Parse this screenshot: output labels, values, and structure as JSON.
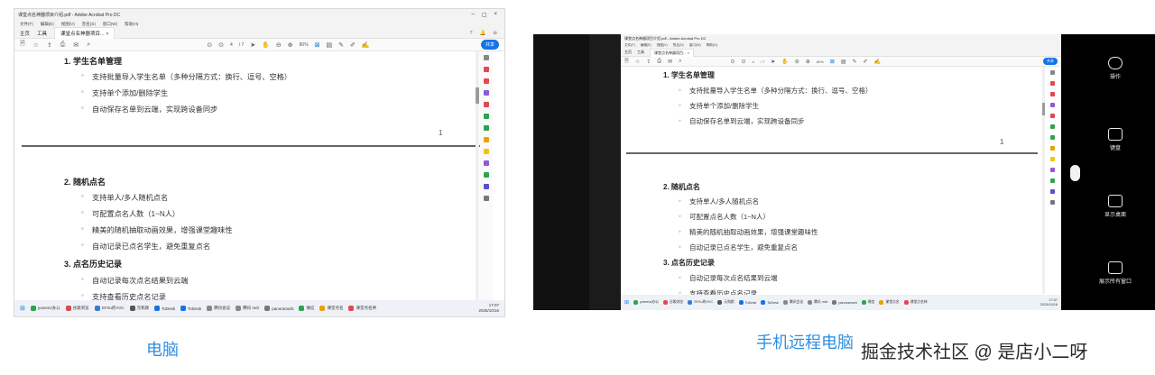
{
  "pc": {
    "title": "课堂点名神器项目介绍.pdf - Adobe Acrobat Pro DC",
    "menu": [
      "文件(F)",
      "编辑(E)",
      "视图(V)",
      "签名(S)",
      "窗口(W)",
      "帮助(H)"
    ],
    "tabs": [
      "主页",
      "工具"
    ],
    "doc_tab": "课堂点名神器项目...",
    "page_input": "4",
    "page_total": "/ 7",
    "zoom": "80%",
    "share_label": "共享",
    "clock_time": "17:07",
    "clock_date": "2025/10/16"
  },
  "phone": {
    "title": "课堂点名神器项目介绍.pdf - Adobe Acrobat Pro DC",
    "menu": [
      "文件(F)",
      "编辑(E)",
      "视图(V)",
      "签名(S)",
      "窗口(W)",
      "帮助(H)"
    ],
    "tabs": [
      "主页",
      "工具"
    ],
    "doc_tab": "课堂点名神器项目...",
    "page_input": "4",
    "page_total": "/ 7",
    "zoom": "80%",
    "share_label": "共享",
    "clock_time": "17:07",
    "clock_date": "2025/10/16",
    "controls": [
      {
        "label": "操作",
        "icon": "toggle-icon"
      },
      {
        "label": "键盘",
        "icon": "keyboard-icon"
      },
      {
        "label": "显示桌面",
        "icon": "desktop-icon"
      },
      {
        "label": "展示所有窗口",
        "icon": "windows-grid-icon"
      }
    ]
  },
  "document": {
    "section1_title": "1. 学生名单管理",
    "section1_items": [
      "支持批量导入学生名单（多种分隔方式：换行、逗号、空格）",
      "支持单个添加/删除学生",
      "自动保存名单到云端，实现跨设备同步"
    ],
    "page_number": "1",
    "section2_title": "2. 随机点名",
    "section2_items": [
      "支持单人/多人随机点名",
      "可配置点名人数（1~N人）",
      "精美的随机抽取动画效果，增强课堂趣味性",
      "自动记录已点名学生，避免重复点名"
    ],
    "section3_title": "3. 点名历史记录",
    "section3_items": [
      "自动记录每次点名结果到云端",
      "支持查看历史点名记录"
    ]
  },
  "taskbar_items": [
    "yumenz办公",
    "谷歌浏览",
    "SFXu的VVC",
    "元和颜",
    "ToDesk",
    "ToDesk",
    "腾讯会议",
    "腾讯 mdr",
    "panoramarb",
    "微信",
    "课堂点名",
    "课堂点名神"
  ],
  "captions": {
    "pc": "电脑",
    "phone": "手机远程电脑"
  },
  "watermark": "掘金技术社区 @ 是店小二呀",
  "colors": {
    "caption_blue": "#2f8fe0",
    "acrobat_blue": "#1473e6"
  }
}
